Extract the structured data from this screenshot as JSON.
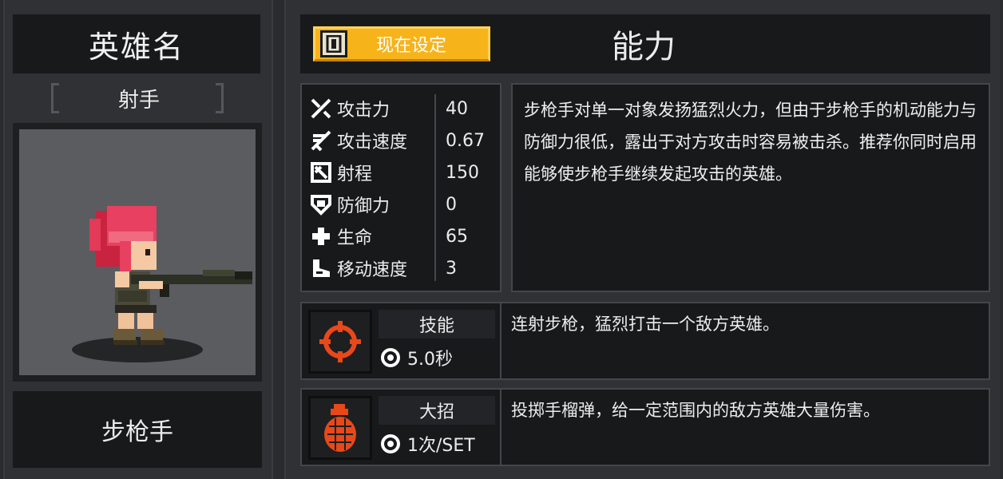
{
  "hero": {
    "title": "英雄名",
    "role": "射手",
    "class_name": "步枪手"
  },
  "top": {
    "set_button_label": "现在设定",
    "ability_title": "能力"
  },
  "stats": [
    {
      "icon": "attack-icon",
      "name": "攻击力",
      "value": "40"
    },
    {
      "icon": "attack-speed-icon",
      "name": "攻击速度",
      "value": "0.67"
    },
    {
      "icon": "range-icon",
      "name": "射程",
      "value": "150"
    },
    {
      "icon": "defense-icon",
      "name": "防御力",
      "value": "0"
    },
    {
      "icon": "health-icon",
      "name": "生命",
      "value": "65"
    },
    {
      "icon": "move-speed-icon",
      "name": "移动速度",
      "value": "3"
    }
  ],
  "description": "步枪手对单一对象发扬猛烈火力，但由于步枪手的机动能力与防御力很低，露出于对方攻击时容易被击杀。推荐你同时启用能够使步枪手继续发起攻击的英雄。",
  "skill": {
    "icon": "crosshair-icon",
    "label": "技能",
    "cooldown": "5.0秒",
    "text": "连射步枪，猛烈打击一个敌方英雄。"
  },
  "ultimate": {
    "icon": "grenade-icon",
    "label": "大招",
    "cooldown": "1次/SET",
    "text": "投掷手榴弹，给一定范围内的敌方英雄大量伤害。"
  },
  "colors": {
    "accent": "#f7b31a",
    "skill_icon": "#e8481a",
    "panel": "#303134",
    "dark": "#18191b"
  }
}
